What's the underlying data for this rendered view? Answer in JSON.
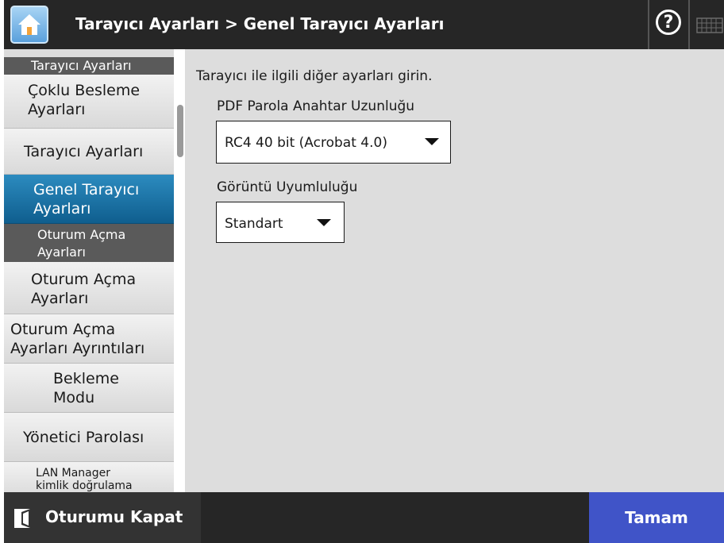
{
  "header": {
    "title": "Tarayıcı Ayarları > Genel Tarayıcı Ayarları",
    "help_label": "?"
  },
  "sidebar": {
    "items": [
      {
        "type": "group",
        "label_lines": [
          "Tarayıcı Ayarları"
        ]
      },
      {
        "type": "item",
        "label_lines": [
          "Çoklu Besleme",
          "Ayarları"
        ]
      },
      {
        "type": "item",
        "label_lines": [
          "Tarayıcı Ayarları"
        ]
      },
      {
        "type": "item",
        "label_lines": [
          "Genel Tarayıcı",
          "Ayarları"
        ],
        "selected": true
      },
      {
        "type": "group",
        "label_lines": [
          "Oturum Açma",
          "Ayarları"
        ]
      },
      {
        "type": "item",
        "label_lines": [
          "Oturum Açma",
          "Ayarları"
        ]
      },
      {
        "type": "item",
        "label_lines": [
          "Oturum Açma",
          "Ayarları Ayrıntıları"
        ]
      },
      {
        "type": "item",
        "label_lines": [
          "Bekleme",
          "Modu"
        ]
      },
      {
        "type": "item",
        "label_lines": [
          "Yönetici Parolası"
        ]
      },
      {
        "type": "item",
        "label_lines": [
          "LAN Manager",
          "kimlik doğrulama"
        ]
      }
    ]
  },
  "main": {
    "instruction": "Tarayıcı ile ilgili diğer ayarları girin.",
    "pdf_password": {
      "label": "PDF Parola Anahtar Uzunluğu",
      "value": "RC4 40 bit (Acrobat 4.0)"
    },
    "image_compat": {
      "label": "Görüntü Uyumluluğu",
      "value": "Standart"
    }
  },
  "footer": {
    "logout_label": "Oturumu Kapat",
    "ok_label": "Tamam"
  },
  "colors": {
    "header_bg": "#262626",
    "selected_item": "#1a6fa3",
    "ok_button": "#4054c8",
    "content_bg": "#dddddd"
  }
}
